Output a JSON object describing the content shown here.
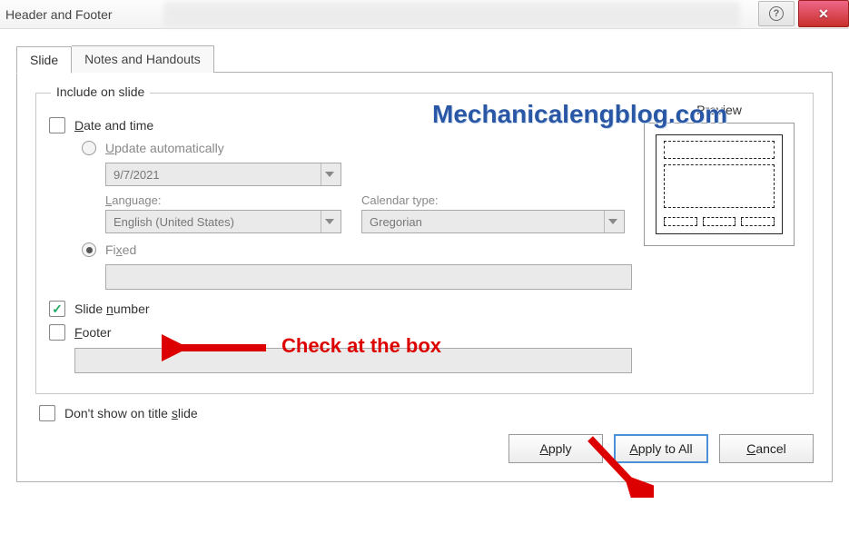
{
  "titlebar": {
    "title": "Header and Footer"
  },
  "tabs": {
    "slide": "Slide",
    "notes": "Notes and Handouts"
  },
  "include": {
    "legend": "Include on slide",
    "date_time": "Date and time",
    "update_auto": "Update automatically",
    "date_value": "9/7/2021",
    "language_label": "Language:",
    "language_value": "English (United States)",
    "calendar_label": "Calendar type:",
    "calendar_value": "Gregorian",
    "fixed": "Fixed",
    "slide_number": "Slide number",
    "footer": "Footer"
  },
  "dont_show": "Don't show on title slide",
  "preview_label": "Preview",
  "buttons": {
    "apply": "Apply",
    "apply_all": "Apply to All",
    "cancel": "Cancel"
  },
  "watermark": "Mechanicalengblog.com",
  "annotation": {
    "check": "Check at the box"
  }
}
